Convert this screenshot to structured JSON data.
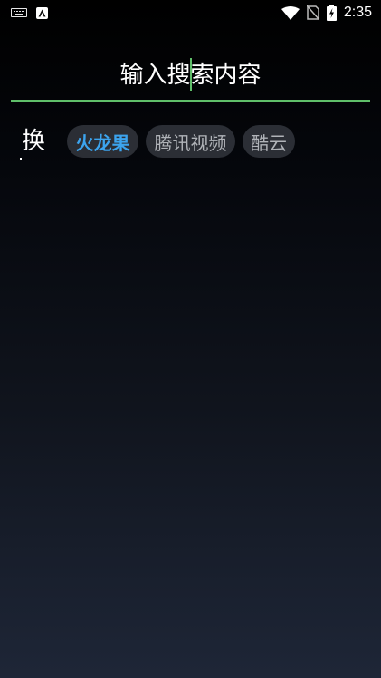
{
  "status_bar": {
    "time": "2:35",
    "left_icons": [
      "keyboard-icon",
      "app-a-icon"
    ],
    "right_icons": [
      "wifi-icon",
      "no-sim-icon",
      "battery-charging-icon"
    ]
  },
  "search": {
    "placeholder": "输入搜索内容",
    "value": ""
  },
  "source": {
    "switch_label": "换",
    "options": [
      {
        "label": "火龙果",
        "active": true
      },
      {
        "label": "腾讯视频",
        "active": false
      },
      {
        "label": "酷云",
        "active": false
      }
    ]
  },
  "colors": {
    "accent_green": "#5fbf6a",
    "active_chip_text": "#3ca4ee",
    "chip_bg": "#2b2e35",
    "chip_text": "#b0b3b8"
  }
}
